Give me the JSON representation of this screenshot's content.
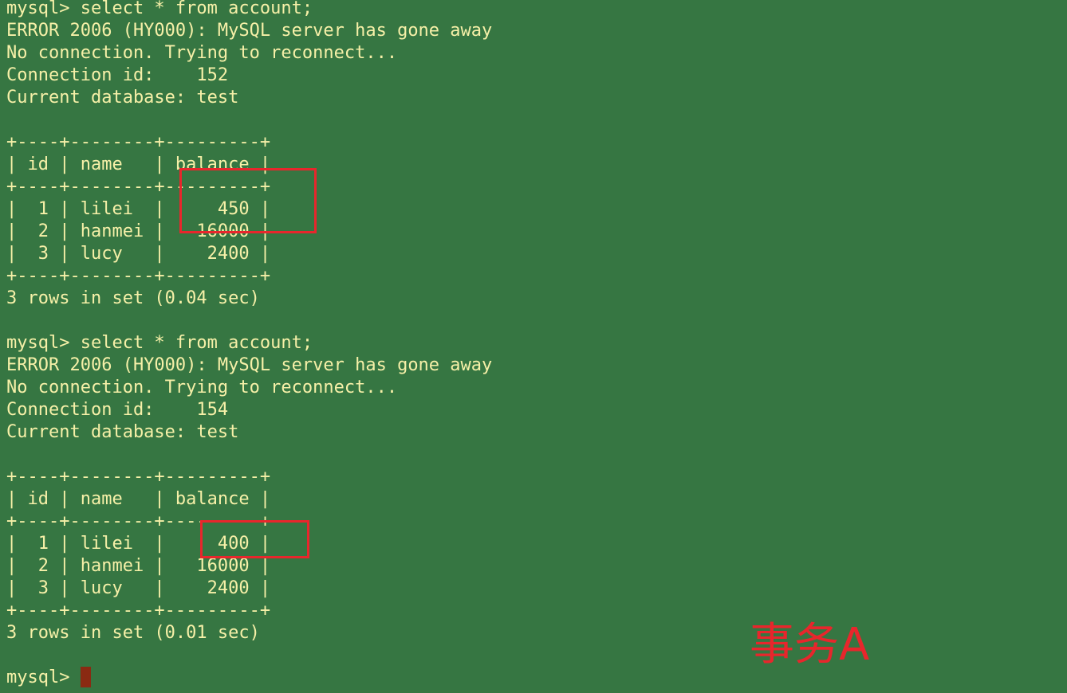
{
  "terminal": {
    "colors": {
      "background": "#367642",
      "text": "#f6f0a8",
      "cursor": "#8a2a12",
      "annotation": "#e8262c"
    },
    "lines": [
      "mysql> select * from account;",
      "ERROR 2006 (HY000): MySQL server has gone away",
      "No connection. Trying to reconnect...",
      "Connection id:    152",
      "Current database: test",
      "",
      "+----+--------+---------+",
      "| id | name   | balance |",
      "+----+--------+---------+",
      "|  1 | lilei  |     450 |",
      "|  2 | hanmei |   16000 |",
      "|  3 | lucy   |    2400 |",
      "+----+--------+---------+",
      "3 rows in set (0.04 sec)",
      "",
      "mysql> select * from account;",
      "ERROR 2006 (HY000): MySQL server has gone away",
      "No connection. Trying to reconnect...",
      "Connection id:    154",
      "Current database: test",
      "",
      "+----+--------+---------+",
      "| id | name   | balance |",
      "+----+--------+---------+",
      "|  1 | lilei  |     400 |",
      "|  2 | hanmei |   16000 |",
      "|  3 | lucy   |    2400 |",
      "+----+--------+---------+",
      "3 rows in set (0.01 sec)",
      "",
      "mysql> "
    ]
  },
  "annotation": {
    "label": "事务A"
  }
}
